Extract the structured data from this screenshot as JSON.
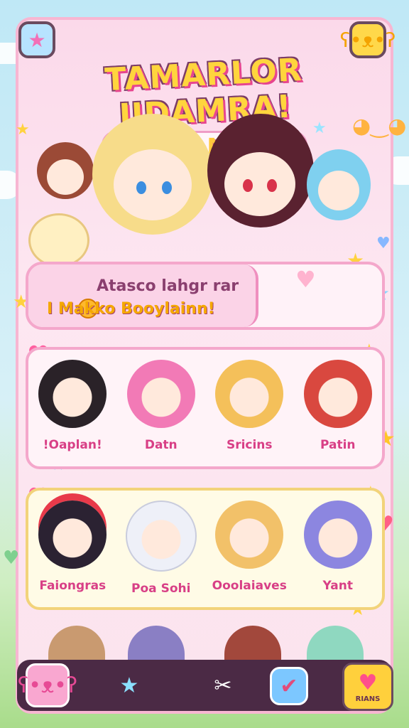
{
  "header": {
    "title": "TAMARLOR IIDAMRA!",
    "subtitle": "aoiinta MOOLE"
  },
  "banner": {
    "line1": "Atasco lahgr rar",
    "line2": "I Makko Booylainn!"
  },
  "grid_row1": [
    {
      "name": "!Oaplan!"
    },
    {
      "name": "Datn"
    },
    {
      "name": "Sricins"
    },
    {
      "name": "Patin"
    }
  ],
  "grid_row2": [
    {
      "name": "Faiongras"
    },
    {
      "name": "Poa Sohi"
    },
    {
      "name": "Ooolaiaves"
    },
    {
      "name": "Yant"
    }
  ],
  "nav": {
    "fav_label": "RIANS"
  },
  "icons": {
    "back": "star-back-icon",
    "profile": "bear-face-icon",
    "home": "bear-home-icon",
    "star": "star-character-icon",
    "tools": "scissors-icon",
    "check": "check-icon",
    "fav": "heart-icon"
  },
  "colors": {
    "panel": "#fbd9ea",
    "accent": "#e7458f",
    "title_fill": "#ffd53d",
    "navbar": "#4b2a45"
  }
}
